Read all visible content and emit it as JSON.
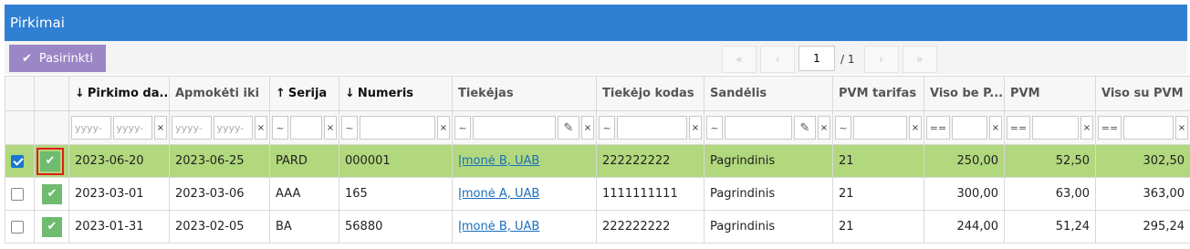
{
  "window": {
    "title": "Pirkimai"
  },
  "toolbar": {
    "pick_label": "Pasirinkti",
    "pager": {
      "first": "«",
      "prev": "‹",
      "next": "›",
      "last": "»",
      "current_page": "1",
      "total": "/ 1"
    }
  },
  "columns": [
    {
      "label": "",
      "sort": ""
    },
    {
      "label": "",
      "sort": ""
    },
    {
      "label": "Pirkimo da...",
      "sort": "↓"
    },
    {
      "label": "Apmokėti iki",
      "sort": ""
    },
    {
      "label": "Serija",
      "sort": "↑"
    },
    {
      "label": "Numeris",
      "sort": "↓"
    },
    {
      "label": "Tiekėjas",
      "sort": ""
    },
    {
      "label": "Tiekėjo kodas",
      "sort": ""
    },
    {
      "label": "Sandėlis",
      "sort": ""
    },
    {
      "label": "PVM tarifas",
      "sort": ""
    },
    {
      "label": "Viso be P...",
      "sort": ""
    },
    {
      "label": "PVM",
      "sort": ""
    },
    {
      "label": "Viso su PVM",
      "sort": ""
    }
  ],
  "filters": {
    "date_from_placeholder": "yyyy-",
    "date_to_placeholder": "yyyy-",
    "op_tilde": "~",
    "op_eq": "==",
    "clear": "×"
  },
  "rows": [
    {
      "selected": true,
      "pirkimo_data": "2023-06-20",
      "apmoketi_iki": "2023-06-25",
      "serija": "PARD",
      "numeris": "000001",
      "tiekejas": "Įmonė B, UAB",
      "tiekejo_kodas": "222222222",
      "sandelis": "Pagrindinis",
      "pvm_tarifas": "21",
      "viso_be_pvm": "250,00",
      "pvm": "52,50",
      "viso_su_pvm": "302,50"
    },
    {
      "selected": false,
      "pirkimo_data": "2023-03-01",
      "apmoketi_iki": "2023-03-06",
      "serija": "AAA",
      "numeris": "165",
      "tiekejas": "Įmonė A, UAB",
      "tiekejo_kodas": "1111111111",
      "sandelis": "Pagrindinis",
      "pvm_tarifas": "21",
      "viso_be_pvm": "300,00",
      "pvm": "63,00",
      "viso_su_pvm": "363,00"
    },
    {
      "selected": false,
      "pirkimo_data": "2023-01-31",
      "apmoketi_iki": "2023-02-05",
      "serija": "BA",
      "numeris": "56880",
      "tiekejas": "Įmonė B, UAB",
      "tiekejo_kodas": "222222222",
      "sandelis": "Pagrindinis",
      "pvm_tarifas": "21",
      "viso_be_pvm": "244,00",
      "pvm": "51,24",
      "viso_su_pvm": "295,24"
    }
  ],
  "colors": {
    "title_bar": "#2f7fd2",
    "pick_button": "#9b86c6",
    "selected_row": "#b1d87c",
    "status_ok": "#6fbb6f",
    "highlight": "#e21b1b"
  },
  "icons": {
    "check": "check-icon",
    "pencil": "pencil-icon",
    "clear": "clear-icon"
  }
}
